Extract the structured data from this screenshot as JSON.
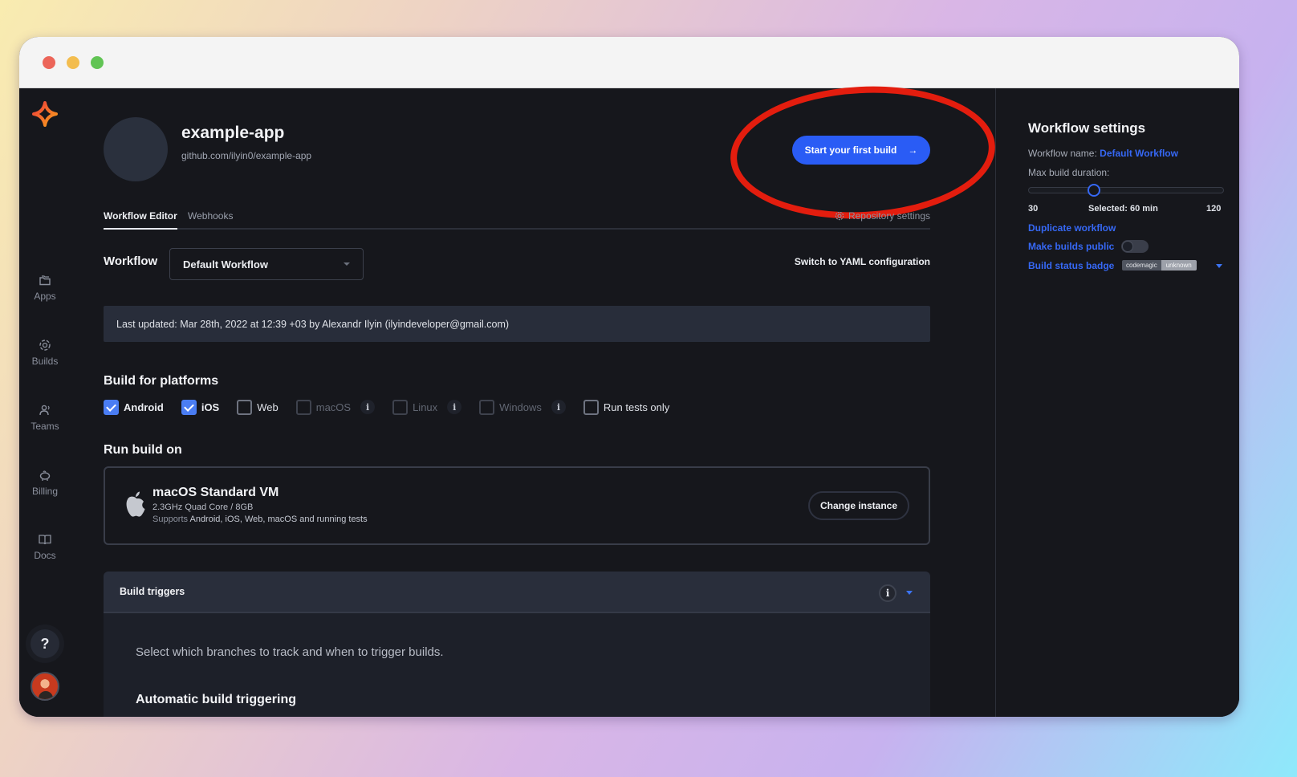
{
  "window": {
    "controls": [
      "close",
      "minimize",
      "maximize"
    ]
  },
  "sidebar": {
    "logo": "codemagic-logo",
    "items": [
      {
        "label": "Apps",
        "icon": "folder-icon"
      },
      {
        "label": "Builds",
        "icon": "builds-icon"
      },
      {
        "label": "Teams",
        "icon": "teams-icon"
      },
      {
        "label": "Billing",
        "icon": "piggy-bank-icon"
      },
      {
        "label": "Docs",
        "icon": "book-icon"
      }
    ],
    "help_label": "?",
    "avatar": "user-avatar"
  },
  "header": {
    "app_name": "example-app",
    "repo_url": "github.com/ilyin0/example-app",
    "start_build_label": "Start your first build",
    "start_build_arrow": "→",
    "annotation": "red-circle-highlight",
    "annotation_color": "#e31d0e"
  },
  "tabs": [
    {
      "label": "Workflow Editor",
      "active": true
    },
    {
      "label": "Webhooks",
      "active": false
    }
  ],
  "repository_settings_label": "Repository settings",
  "workflow": {
    "label": "Workflow",
    "selected": "Default Workflow",
    "yaml_link": "Switch to YAML configuration"
  },
  "last_updated": "Last updated: Mar 28th, 2022 at 12:39 +03 by Alexandr Ilyin (ilyindeveloper@gmail.com)",
  "platforms": {
    "title": "Build for platforms",
    "items": [
      {
        "label": "Android",
        "checked": true,
        "disabled": false,
        "info": false
      },
      {
        "label": "iOS",
        "checked": true,
        "disabled": false,
        "info": false
      },
      {
        "label": "Web",
        "checked": false,
        "disabled": false,
        "info": false
      },
      {
        "label": "macOS",
        "checked": false,
        "disabled": true,
        "info": true
      },
      {
        "label": "Linux",
        "checked": false,
        "disabled": true,
        "info": true
      },
      {
        "label": "Windows",
        "checked": false,
        "disabled": true,
        "info": true
      },
      {
        "label": "Run tests only",
        "checked": false,
        "disabled": false,
        "info": false
      }
    ]
  },
  "run_build": {
    "title": "Run build on",
    "instance_name": "macOS Standard VM",
    "spec": "2.3GHz Quad Core / 8GB",
    "supports_prefix": "Supports",
    "supports_list": "Android, iOS, Web, macOS and running tests",
    "change_label": "Change instance"
  },
  "triggers": {
    "title": "Build triggers",
    "info": "i",
    "description": "Select which branches to track and when to trigger builds.",
    "auto_title": "Automatic build triggering"
  },
  "settings": {
    "title": "Workflow settings",
    "name_label": "Workflow name:",
    "name_value": "Default Workflow",
    "duration_label": "Max build duration:",
    "duration_min": "30",
    "duration_max": "120",
    "duration_selected_value": 60,
    "duration_min_value": 30,
    "duration_max_value": 120,
    "duration_selected_label": "Selected: 60 min",
    "duplicate_label": "Duplicate workflow",
    "public_label": "Make builds public",
    "public_enabled": false,
    "badge_label": "Build status badge",
    "badge_left": "codemagic",
    "badge_right": "unknown"
  },
  "colors": {
    "accent": "#2a5cf5",
    "link": "#3668f5",
    "checkbox": "#4a7df3",
    "background": "#16171c"
  }
}
